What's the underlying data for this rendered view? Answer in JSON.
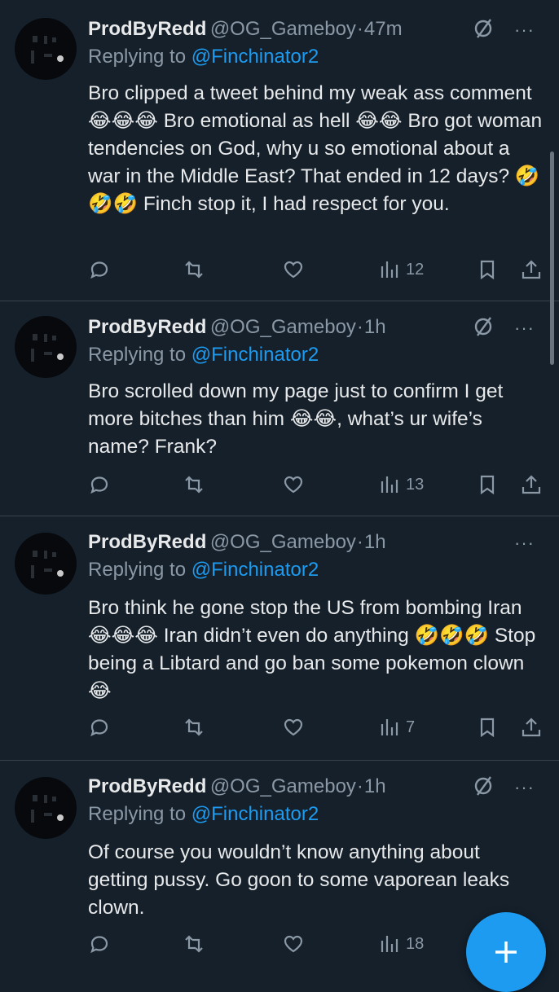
{
  "tweets": [
    {
      "name": "ProdByRedd",
      "handle": "@OG_Gameboy",
      "time": "47m",
      "replying_label": "Replying to",
      "replying_to": "@Finchinator2",
      "text": "Bro clipped a tweet behind my weak ass comment 😂😂😂 Bro emotional as hell 😂😂 Bro got woman tendencies on God, why u so emotional about a war in the Middle East? That ended in 12 days? 🤣🤣🤣 Finch stop it, I had respect for you.",
      "views": "12",
      "has_grok": true
    },
    {
      "name": "ProdByRedd",
      "handle": "@OG_Gameboy",
      "time": "1h",
      "replying_label": "Replying to",
      "replying_to": "@Finchinator2",
      "text": "Bro scrolled down my page just to confirm I get more bitches than him 😂😂, what’s ur wife’s name? Frank?",
      "views": "13",
      "has_grok": true
    },
    {
      "name": "ProdByRedd",
      "handle": "@OG_Gameboy",
      "time": "1h",
      "replying_label": "Replying to",
      "replying_to": "@Finchinator2",
      "text": "Bro think he gone stop the US from bombing Iran 😂😂😂 Iran didn’t even do anything 🤣🤣🤣 Stop being a Libtard and go ban some pokemon clown 😂",
      "views": "7",
      "has_grok": false
    },
    {
      "name": "ProdByRedd",
      "handle": "@OG_Gameboy",
      "time": "1h",
      "replying_label": "Replying to",
      "replying_to": "@Finchinator2",
      "text": "Of course you wouldn’t know anything about getting pussy. Go goon to some vaporean leaks clown.",
      "views": "18",
      "has_grok": true
    }
  ],
  "separator": "·",
  "more_glyph": "···",
  "icons": {
    "reply": "reply-icon",
    "retweet": "retweet-icon",
    "like": "like-icon",
    "views": "views-icon",
    "bookmark": "bookmark-icon",
    "share": "share-icon",
    "grok": "grok-icon",
    "compose": "plus-icon"
  },
  "colors": {
    "background": "#15202b",
    "accent": "#1d9bf0",
    "muted": "#8b98a5",
    "text": "#e7e9ea"
  }
}
